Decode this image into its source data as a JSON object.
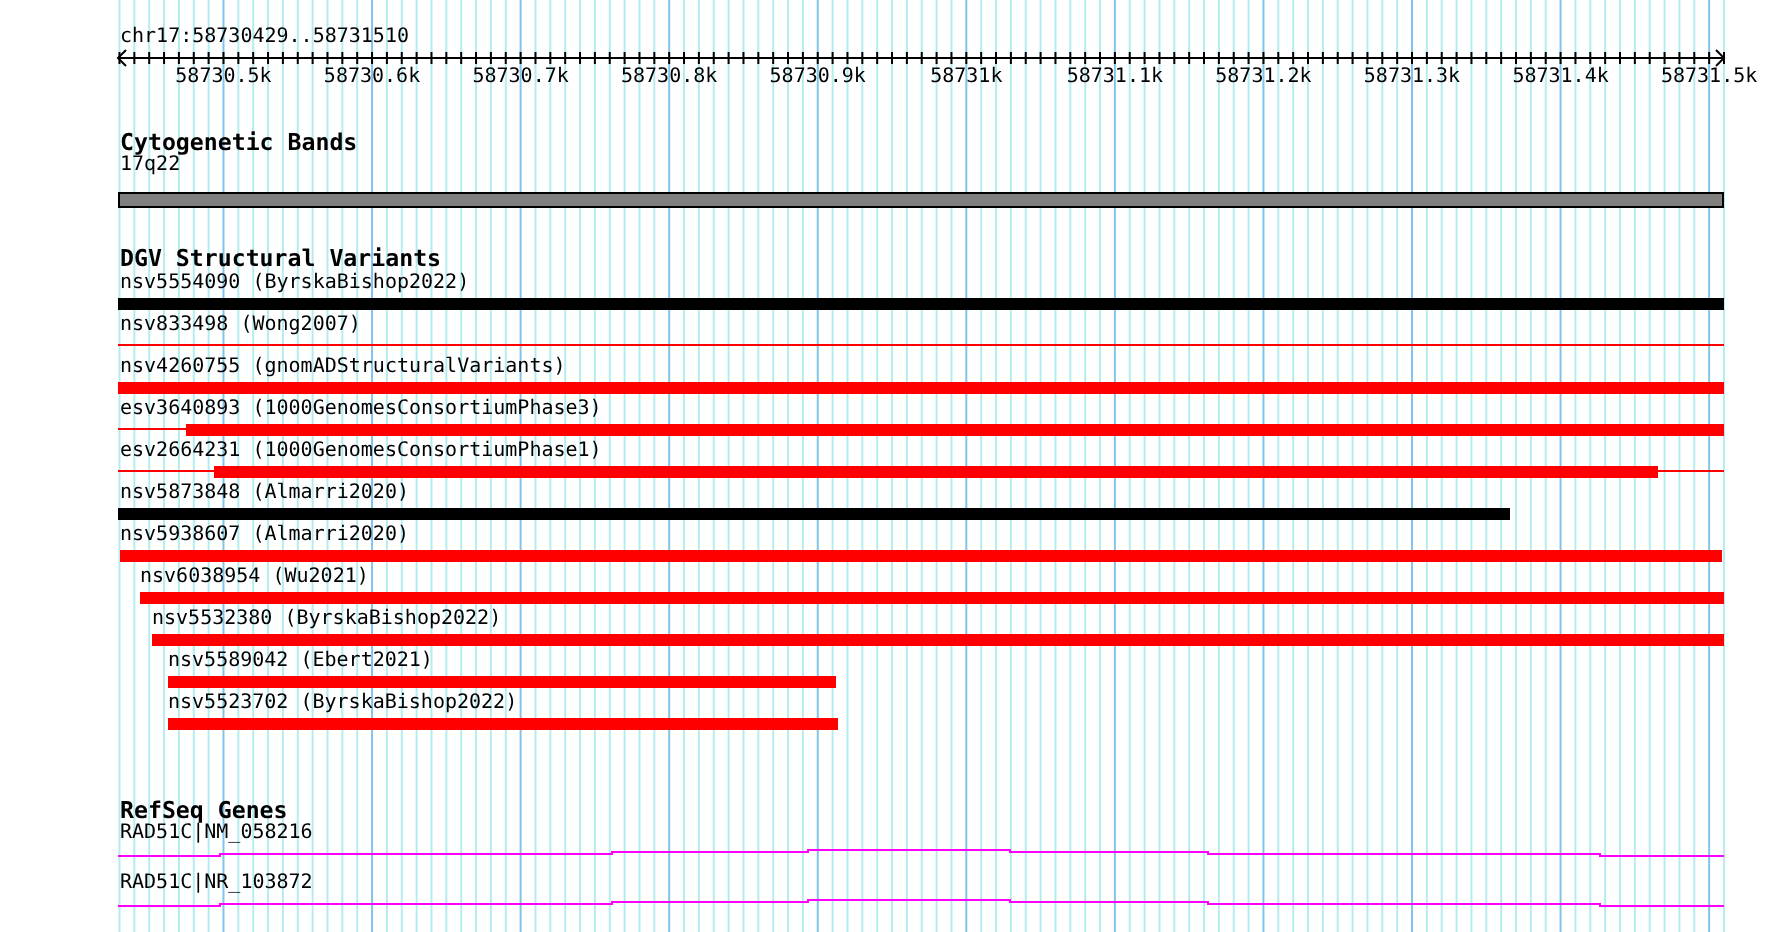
{
  "ruler": {
    "region": "chr17:58730429..58731510",
    "tick_labels": [
      "58730.5k",
      "58730.6k",
      "58730.7k",
      "58730.8k",
      "58730.9k",
      "58731k",
      "58731.1k",
      "58731.2k",
      "58731.3k",
      "58731.4k",
      "58731.5k"
    ]
  },
  "tracks": [
    {
      "title": "Cytogenetic Bands",
      "kind": "bands",
      "features": [
        {
          "label": "17q22"
        }
      ]
    },
    {
      "title": "DGV Structural Variants",
      "kind": "variants",
      "features": [
        {
          "label": "nsv5554090 (ByrskaBishop2022)",
          "color": "#000000",
          "kind": "bar"
        },
        {
          "label": "nsv833498 (Wong2007)",
          "color": "#ff0000",
          "kind": "line"
        },
        {
          "label": "nsv4260755 (gnomADStructuralVariants)",
          "color": "#ff0000",
          "kind": "bar"
        },
        {
          "label": "esv3640893 (1000GenomesConsortiumPhase3)",
          "color": "#ff0000",
          "kind": "bar"
        },
        {
          "label": "esv2664231 (1000GenomesConsortiumPhase1)",
          "color": "#ff0000",
          "kind": "bar"
        },
        {
          "label": "nsv5873848 (Almarri2020)",
          "color": "#000000",
          "kind": "bar"
        },
        {
          "label": "nsv5938607 (Almarri2020)",
          "color": "#ff0000",
          "kind": "bar"
        },
        {
          "label": "nsv6038954 (Wu2021)",
          "color": "#ff0000",
          "kind": "bar"
        },
        {
          "label": "nsv5532380 (ByrskaBishop2022)",
          "color": "#ff0000",
          "kind": "bar"
        },
        {
          "label": "nsv5589042 (Ebert2021)",
          "color": "#ff0000",
          "kind": "bar"
        },
        {
          "label": "nsv5523702 (ByrskaBishop2022)",
          "color": "#ff0000",
          "kind": "bar"
        }
      ]
    },
    {
      "title": "RefSeq Genes",
      "kind": "genes",
      "features": [
        {
          "label": "RAD51C|NM_058216"
        },
        {
          "label": "RAD51C|NR_103872"
        }
      ]
    }
  ]
}
